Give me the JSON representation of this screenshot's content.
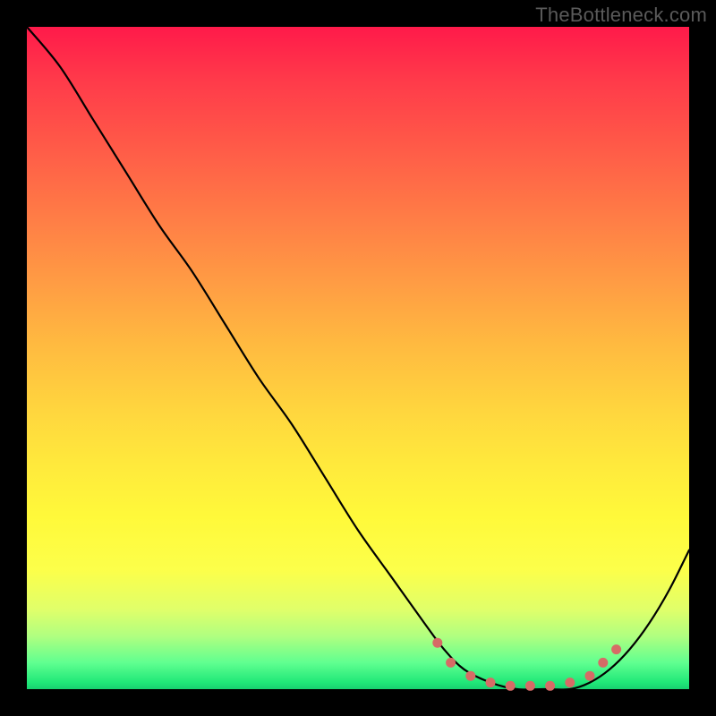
{
  "watermark": "TheBottleneck.com",
  "chart_data": {
    "type": "line",
    "title": "",
    "xlabel": "",
    "ylabel": "",
    "xlim": [
      0,
      100
    ],
    "ylim": [
      0,
      100
    ],
    "grid": false,
    "legend": false,
    "background": "rainbow-gradient (red top → green bottom)",
    "series": [
      {
        "name": "bottleneck-curve",
        "color": "#000000",
        "x": [
          0,
          5,
          10,
          15,
          20,
          25,
          30,
          35,
          40,
          45,
          50,
          55,
          60,
          63,
          66,
          70,
          74,
          78,
          82,
          85,
          88,
          91,
          94,
          97,
          100
        ],
        "values": [
          100,
          94,
          86,
          78,
          70,
          63,
          55,
          47,
          40,
          32,
          24,
          17,
          10,
          6,
          3,
          1,
          0,
          0,
          0,
          1,
          3,
          6,
          10,
          15,
          21
        ]
      }
    ],
    "markers": [
      {
        "x": 62,
        "y": 7
      },
      {
        "x": 64,
        "y": 4
      },
      {
        "x": 67,
        "y": 2
      },
      {
        "x": 70,
        "y": 1
      },
      {
        "x": 73,
        "y": 0.5
      },
      {
        "x": 76,
        "y": 0.5
      },
      {
        "x": 79,
        "y": 0.5
      },
      {
        "x": 82,
        "y": 1
      },
      {
        "x": 85,
        "y": 2
      },
      {
        "x": 87,
        "y": 4
      },
      {
        "x": 89,
        "y": 6
      }
    ],
    "marker_color": "#d66b66"
  }
}
